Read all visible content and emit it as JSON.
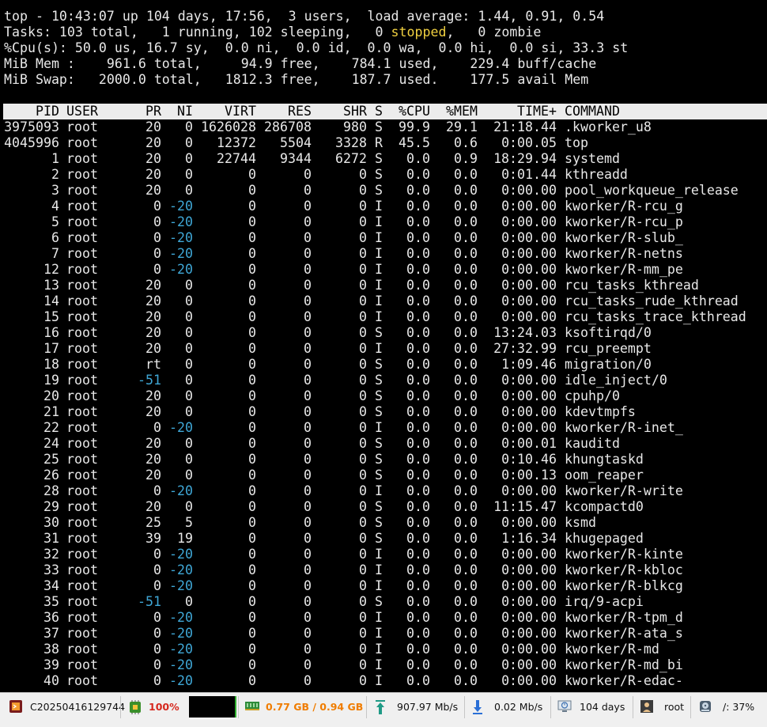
{
  "summary": {
    "line1": "top - 10:43:07 up 104 days, 17:56,  3 users,  load average: 1.44, 0.91, 0.54",
    "line2_pre": "Tasks: 103 total,   1 running, 102 sleeping,   0 ",
    "line2_stopped": "stopped",
    "line2_post": ",   0 zombie",
    "line3": "%Cpu(s): 50.0 us, 16.7 sy,  0.0 ni,  0.0 id,  0.0 wa,  0.0 hi,  0.0 si, 33.3 st",
    "line4": "MiB Mem :    961.6 total,     94.9 free,    784.1 used,    229.4 buff/cache",
    "line5": "MiB Swap:   2000.0 total,   1812.3 free,    187.7 used.    177.5 avail Mem"
  },
  "columns": [
    "PID",
    "USER",
    "PR",
    "NI",
    "VIRT",
    "RES",
    "SHR",
    "S",
    "%CPU",
    "%MEM",
    "TIME+",
    "COMMAND"
  ],
  "processes": [
    [
      "3975093",
      "root",
      "20",
      "0",
      "1626028",
      "286708",
      "980",
      "S",
      "99.9",
      "29.1",
      "21:18.44",
      ".kworker_u8"
    ],
    [
      "4045996",
      "root",
      "20",
      "0",
      "12372",
      "5504",
      "3328",
      "R",
      "45.5",
      "0.6",
      "0:00.05",
      "top"
    ],
    [
      "1",
      "root",
      "20",
      "0",
      "22744",
      "9344",
      "6272",
      "S",
      "0.0",
      "0.9",
      "18:29.94",
      "systemd"
    ],
    [
      "2",
      "root",
      "20",
      "0",
      "0",
      "0",
      "0",
      "S",
      "0.0",
      "0.0",
      "0:01.44",
      "kthreadd"
    ],
    [
      "3",
      "root",
      "20",
      "0",
      "0",
      "0",
      "0",
      "S",
      "0.0",
      "0.0",
      "0:00.00",
      "pool_workqueue_release"
    ],
    [
      "4",
      "root",
      "0",
      "-20",
      "0",
      "0",
      "0",
      "I",
      "0.0",
      "0.0",
      "0:00.00",
      "kworker/R-rcu_g"
    ],
    [
      "5",
      "root",
      "0",
      "-20",
      "0",
      "0",
      "0",
      "I",
      "0.0",
      "0.0",
      "0:00.00",
      "kworker/R-rcu_p"
    ],
    [
      "6",
      "root",
      "0",
      "-20",
      "0",
      "0",
      "0",
      "I",
      "0.0",
      "0.0",
      "0:00.00",
      "kworker/R-slub_"
    ],
    [
      "7",
      "root",
      "0",
      "-20",
      "0",
      "0",
      "0",
      "I",
      "0.0",
      "0.0",
      "0:00.00",
      "kworker/R-netns"
    ],
    [
      "12",
      "root",
      "0",
      "-20",
      "0",
      "0",
      "0",
      "I",
      "0.0",
      "0.0",
      "0:00.00",
      "kworker/R-mm_pe"
    ],
    [
      "13",
      "root",
      "20",
      "0",
      "0",
      "0",
      "0",
      "I",
      "0.0",
      "0.0",
      "0:00.00",
      "rcu_tasks_kthread"
    ],
    [
      "14",
      "root",
      "20",
      "0",
      "0",
      "0",
      "0",
      "I",
      "0.0",
      "0.0",
      "0:00.00",
      "rcu_tasks_rude_kthread"
    ],
    [
      "15",
      "root",
      "20",
      "0",
      "0",
      "0",
      "0",
      "I",
      "0.0",
      "0.0",
      "0:00.00",
      "rcu_tasks_trace_kthread"
    ],
    [
      "16",
      "root",
      "20",
      "0",
      "0",
      "0",
      "0",
      "S",
      "0.0",
      "0.0",
      "13:24.03",
      "ksoftirqd/0"
    ],
    [
      "17",
      "root",
      "20",
      "0",
      "0",
      "0",
      "0",
      "I",
      "0.0",
      "0.0",
      "27:32.99",
      "rcu_preempt"
    ],
    [
      "18",
      "root",
      "rt",
      "0",
      "0",
      "0",
      "0",
      "S",
      "0.0",
      "0.0",
      "1:09.46",
      "migration/0"
    ],
    [
      "19",
      "root",
      "-51",
      "0",
      "0",
      "0",
      "0",
      "S",
      "0.0",
      "0.0",
      "0:00.00",
      "idle_inject/0"
    ],
    [
      "20",
      "root",
      "20",
      "0",
      "0",
      "0",
      "0",
      "S",
      "0.0",
      "0.0",
      "0:00.00",
      "cpuhp/0"
    ],
    [
      "21",
      "root",
      "20",
      "0",
      "0",
      "0",
      "0",
      "S",
      "0.0",
      "0.0",
      "0:00.00",
      "kdevtmpfs"
    ],
    [
      "22",
      "root",
      "0",
      "-20",
      "0",
      "0",
      "0",
      "I",
      "0.0",
      "0.0",
      "0:00.00",
      "kworker/R-inet_"
    ],
    [
      "24",
      "root",
      "20",
      "0",
      "0",
      "0",
      "0",
      "S",
      "0.0",
      "0.0",
      "0:00.01",
      "kauditd"
    ],
    [
      "25",
      "root",
      "20",
      "0",
      "0",
      "0",
      "0",
      "S",
      "0.0",
      "0.0",
      "0:10.46",
      "khungtaskd"
    ],
    [
      "26",
      "root",
      "20",
      "0",
      "0",
      "0",
      "0",
      "S",
      "0.0",
      "0.0",
      "0:00.13",
      "oom_reaper"
    ],
    [
      "28",
      "root",
      "0",
      "-20",
      "0",
      "0",
      "0",
      "I",
      "0.0",
      "0.0",
      "0:00.00",
      "kworker/R-write"
    ],
    [
      "29",
      "root",
      "20",
      "0",
      "0",
      "0",
      "0",
      "S",
      "0.0",
      "0.0",
      "11:15.47",
      "kcompactd0"
    ],
    [
      "30",
      "root",
      "25",
      "5",
      "0",
      "0",
      "0",
      "S",
      "0.0",
      "0.0",
      "0:00.00",
      "ksmd"
    ],
    [
      "31",
      "root",
      "39",
      "19",
      "0",
      "0",
      "0",
      "S",
      "0.0",
      "0.0",
      "1:16.34",
      "khugepaged"
    ],
    [
      "32",
      "root",
      "0",
      "-20",
      "0",
      "0",
      "0",
      "I",
      "0.0",
      "0.0",
      "0:00.00",
      "kworker/R-kinte"
    ],
    [
      "33",
      "root",
      "0",
      "-20",
      "0",
      "0",
      "0",
      "I",
      "0.0",
      "0.0",
      "0:00.00",
      "kworker/R-kbloc"
    ],
    [
      "34",
      "root",
      "0",
      "-20",
      "0",
      "0",
      "0",
      "I",
      "0.0",
      "0.0",
      "0:00.00",
      "kworker/R-blkcg"
    ],
    [
      "35",
      "root",
      "-51",
      "0",
      "0",
      "0",
      "0",
      "S",
      "0.0",
      "0.0",
      "0:00.00",
      "irq/9-acpi"
    ],
    [
      "36",
      "root",
      "0",
      "-20",
      "0",
      "0",
      "0",
      "I",
      "0.0",
      "0.0",
      "0:00.00",
      "kworker/R-tpm_d"
    ],
    [
      "37",
      "root",
      "0",
      "-20",
      "0",
      "0",
      "0",
      "I",
      "0.0",
      "0.0",
      "0:00.00",
      "kworker/R-ata_s"
    ],
    [
      "38",
      "root",
      "0",
      "-20",
      "0",
      "0",
      "0",
      "I",
      "0.0",
      "0.0",
      "0:00.00",
      "kworker/R-md"
    ],
    [
      "39",
      "root",
      "0",
      "-20",
      "0",
      "0",
      "0",
      "I",
      "0.0",
      "0.0",
      "0:00.00",
      "kworker/R-md_bi"
    ],
    [
      "40",
      "root",
      "0",
      "-20",
      "0",
      "0",
      "0",
      "I",
      "0.0",
      "0.0",
      "0:00.00",
      "kworker/R-edac-"
    ]
  ],
  "taskbar": {
    "host": "C20250416129744",
    "cpu": "100%",
    "memory": "0.77 GB / 0.94 GB",
    "upload": "907.97 Mb/s",
    "download": "0.02 Mb/s",
    "uptime": "104 days",
    "user": "root",
    "disk": "/: 37%"
  },
  "colors": {
    "terminal_bg": "#000000",
    "terminal_fg": "#e8e8e8",
    "header_row_bg": "#ececec",
    "stopped_yellow": "#f0d040",
    "priority_blue": "#3fa7d6",
    "cpu_red": "#d6281e",
    "memory_orange": "#f07d00"
  },
  "icons": [
    "terminal-icon",
    "cpu-icon",
    "memory-icon",
    "upload-icon",
    "download-icon",
    "uptime-icon",
    "user-icon",
    "disk-icon"
  ]
}
